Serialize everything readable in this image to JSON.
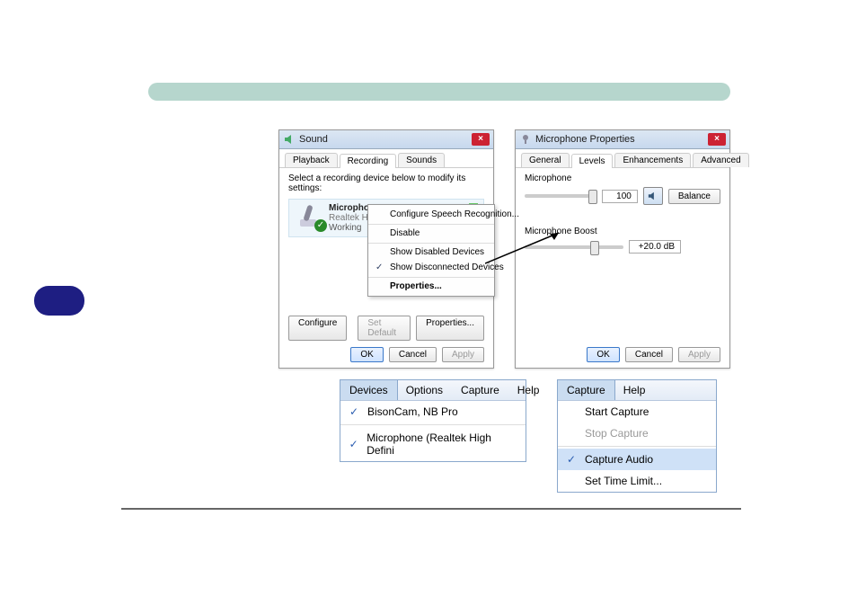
{
  "soundDialog": {
    "title": "Sound",
    "tabs": [
      "Playback",
      "Recording",
      "Sounds"
    ],
    "activeTab": 1,
    "instruction": "Select a recording device below to modify its settings:",
    "device": {
      "name": "Microphone",
      "sub": "Realtek High Definition Audio",
      "status": "Working"
    },
    "context": {
      "i0": "Configure Speech Recognition...",
      "i1": "Disable",
      "i2": "Show Disabled Devices",
      "i3": "Show Disconnected Devices",
      "i4": "Properties..."
    },
    "buttons": {
      "configure": "Configure",
      "setDefault": "Set Default",
      "properties": "Properties...",
      "ok": "OK",
      "cancel": "Cancel",
      "apply": "Apply"
    }
  },
  "micProps": {
    "title": "Microphone Properties",
    "tabs": [
      "General",
      "Levels",
      "Enhancements",
      "Advanced"
    ],
    "activeTab": 1,
    "group1": {
      "label": "Microphone",
      "value": "100",
      "balance": "Balance"
    },
    "group2": {
      "label": "Microphone Boost",
      "value": "+20.0 dB"
    },
    "buttons": {
      "ok": "OK",
      "cancel": "Cancel",
      "apply": "Apply"
    }
  },
  "devicesMenu": {
    "items": [
      "Devices",
      "Options",
      "Capture",
      "Help"
    ],
    "open": 0,
    "list": {
      "i0": "BisonCam, NB Pro",
      "i1": "Microphone (Realtek High Defini"
    }
  },
  "captureMenu": {
    "items": [
      "Capture",
      "Help"
    ],
    "open": 0,
    "list": {
      "i0": "Start Capture",
      "i1": "Stop Capture",
      "i2": "Capture Audio",
      "i3": "Set Time Limit..."
    }
  }
}
